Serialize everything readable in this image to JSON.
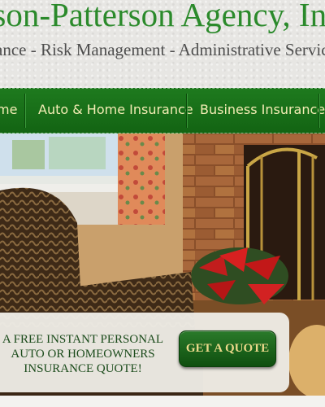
{
  "header": {
    "title": "lson-Patterson Agency, In",
    "tagline": "ance - Risk Management - Administrative Servic"
  },
  "nav": {
    "items": [
      {
        "label": "me"
      },
      {
        "label": "Auto & Home Insurance"
      },
      {
        "label": "Business Insurance"
      }
    ]
  },
  "hero": {
    "image": "living room with wicker chair, window with floral curtains, brick fireplace and red poinsettia"
  },
  "quote": {
    "lines": [
      "A FREE INSTANT PERSONAL",
      "AUTO OR HOMEOWNERS",
      "INSURANCE QUOTE!"
    ],
    "button_label": "GET A QUOTE"
  },
  "colors": {
    "title_green": "#2b8a2b",
    "nav_green": "#1a701a",
    "nav_text": "#f3ecb4",
    "button_text": "#ecd98b"
  }
}
